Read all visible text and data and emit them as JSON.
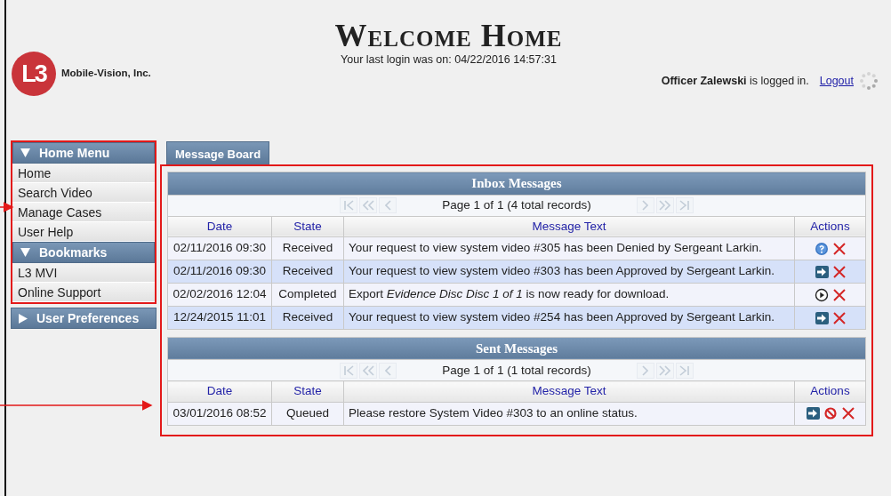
{
  "header": {
    "logo": {
      "mark": "L3",
      "name": "Mobile-Vision, Inc."
    },
    "title": "Welcome Home",
    "last_login": "Your last login was on: 04/22/2016 14:57:31",
    "user": {
      "name": "Officer Zalewski",
      "status": "is logged in.",
      "logout": "Logout"
    }
  },
  "sidebar": {
    "sections": [
      {
        "title": "Home Menu",
        "expanded": true,
        "items": [
          "Home",
          "Search Video",
          "Manage Cases",
          "User Help"
        ]
      },
      {
        "title": "Bookmarks",
        "expanded": true,
        "items": [
          "L3 MVI",
          "Online Support"
        ]
      },
      {
        "title": "User Preferences",
        "expanded": false
      }
    ]
  },
  "tabs": [
    {
      "label": "Message Board",
      "selected": true
    }
  ],
  "tables": [
    {
      "title": "Inbox Messages",
      "pager": {
        "text": "Page 1 of 1 (4 total records)",
        "buttons": [
          {
            "kind": "first",
            "disabled": true
          },
          {
            "kind": "prev-page",
            "disabled": true
          },
          {
            "kind": "prev",
            "disabled": true
          },
          {
            "kind": "next",
            "disabled": true
          },
          {
            "kind": "next-page",
            "disabled": true
          },
          {
            "kind": "last",
            "disabled": true
          }
        ]
      },
      "columns": [
        "Date",
        "State",
        "Message Text",
        "Actions"
      ],
      "rows": [
        {
          "date": "02/11/2016 09:30",
          "state": "Received",
          "message": "Your request to view system video #305 has been Denied by Sergeant Larkin.",
          "actions": [
            {
              "kind": "help"
            },
            {
              "kind": "delete"
            }
          ]
        },
        {
          "date": "02/11/2016 09:30",
          "state": "Received",
          "message": "Your request to view system video #303 has been Approved by Sergeant Larkin.",
          "actions": [
            {
              "kind": "go"
            },
            {
              "kind": "delete"
            }
          ]
        },
        {
          "date": "02/02/2016 12:04",
          "state": "Completed",
          "message": "Export *Evidence Disc Disc 1 of 1* is now ready for download.",
          "actions": [
            {
              "kind": "play"
            },
            {
              "kind": "delete"
            }
          ]
        },
        {
          "date": "12/24/2015 11:01",
          "state": "Received",
          "message": "Your request to view system video #254 has been Approved by Sergeant Larkin.",
          "actions": [
            {
              "kind": "go"
            },
            {
              "kind": "delete"
            }
          ]
        }
      ]
    },
    {
      "title": "Sent Messages",
      "pager": {
        "text": "Page 1 of 1 (1 total records)",
        "buttons": [
          {
            "kind": "first",
            "disabled": true
          },
          {
            "kind": "prev-page",
            "disabled": true
          },
          {
            "kind": "prev",
            "disabled": true
          },
          {
            "kind": "next",
            "disabled": true
          },
          {
            "kind": "next-page",
            "disabled": true
          },
          {
            "kind": "last",
            "disabled": true
          }
        ]
      },
      "columns": [
        "Date",
        "State",
        "Message Text",
        "Actions"
      ],
      "rows": [
        {
          "date": "03/01/2016 08:52",
          "state": "Queued",
          "message": "Please restore System Video #303 to an online status.",
          "actions": [
            {
              "kind": "go"
            },
            {
              "kind": "cancel"
            },
            {
              "kind": "delete"
            }
          ]
        }
      ]
    }
  ]
}
